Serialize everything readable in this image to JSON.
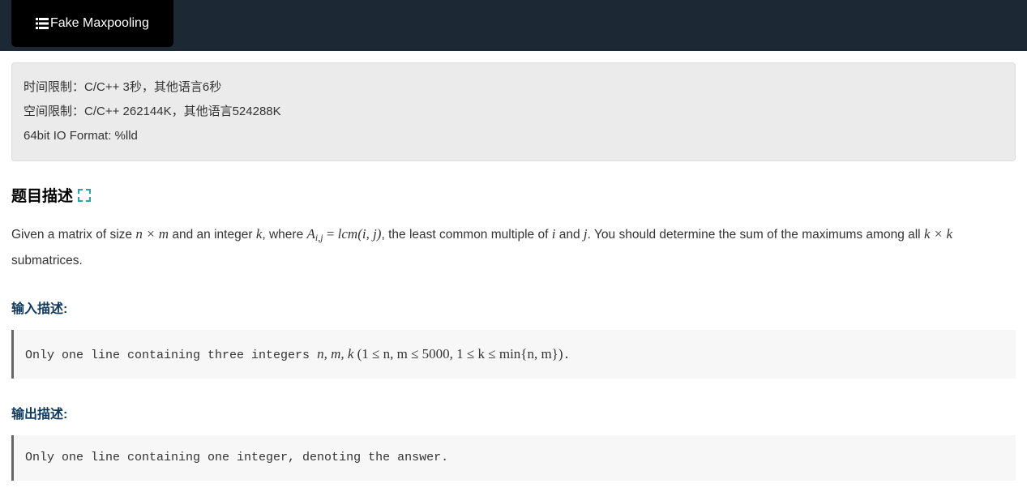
{
  "tab": {
    "title": "Fake Maxpooling"
  },
  "limits": {
    "time": "时间限制：C/C++ 3秒，其他语言6秒",
    "space": "空间限制：C/C++ 262144K，其他语言524288K",
    "io_format": "64bit IO Format: %lld"
  },
  "sections": {
    "problem_title": "题目描述",
    "input_title": "输入描述:",
    "output_title": "输出描述:"
  },
  "description": {
    "part1": "Given a matrix of size ",
    "math1": "n × m",
    "part2": " and an integer ",
    "math2": "k",
    "part3": ", where ",
    "math3_lhs": "A",
    "math3_sub": "i,j",
    "math3_eq": " = ",
    "math3_rhs": "lcm(i, j)",
    "part4": ", the least common multiple of ",
    "math4": "i",
    "part5": " and ",
    "math5": "j",
    "part6": ". You should determine the sum of the maximums among all ",
    "math6": "k × k",
    "part7": " submatrices."
  },
  "input": {
    "text": "Only one line containing three integers ",
    "math_vars": "n, m, k ",
    "math_constraint": "(1 ≤ n, m ≤ 5000, 1 ≤ k ≤ min{n, m})",
    "period": "."
  },
  "output": {
    "text": "Only one line containing one integer, denoting the answer."
  }
}
